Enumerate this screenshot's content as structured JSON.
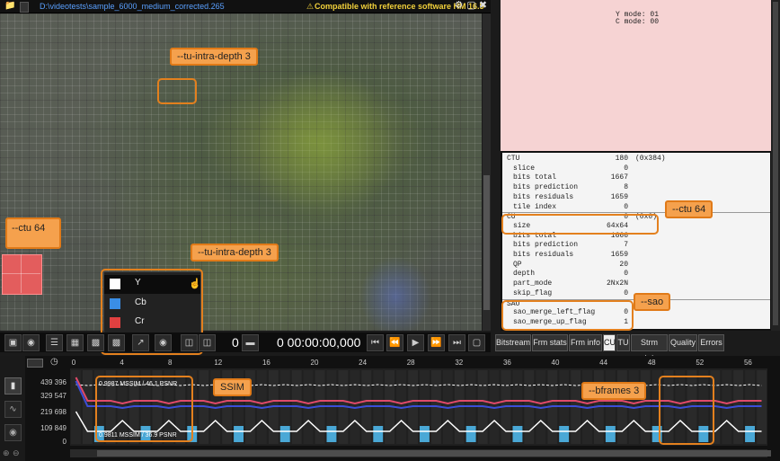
{
  "title_bar": {
    "file_path": "D:\\videotests\\sample_6000_medium_corrected.265",
    "compat_text": "Compatible with reference software HM 16.5"
  },
  "annotations": {
    "tu_intra_depth_top": "--tu-intra-depth 3",
    "tu_intra_depth_bottom": "--tu-intra-depth 3",
    "ctu_left": "--ctu 64",
    "ctu_right": "--ctu 64",
    "sao": "--sao",
    "ssim": "SSIM",
    "bframes": "--bframes 3"
  },
  "component_menu": {
    "items": [
      {
        "label": "Y",
        "color": "#ffffff"
      },
      {
        "label": "Cb",
        "color": "#3a8ee6"
      },
      {
        "label": "Cr",
        "color": "#e04040"
      }
    ]
  },
  "player": {
    "frame": "0",
    "timecode": "0 00:00:00,000"
  },
  "yuv_mode": {
    "line1": "Y mode: 01",
    "line2": "C mode: 00"
  },
  "info_rows": [
    {
      "key": "CTU",
      "val": "180",
      "extra": "(0x384)",
      "indent": false,
      "sep": false
    },
    {
      "key": "slice",
      "val": "0",
      "extra": "",
      "indent": true,
      "sep": false
    },
    {
      "key": "bits total",
      "val": "1667",
      "extra": "",
      "indent": true,
      "sep": false
    },
    {
      "key": "bits prediction",
      "val": "8",
      "extra": "",
      "indent": true,
      "sep": false
    },
    {
      "key": "bits residuals",
      "val": "1659",
      "extra": "",
      "indent": true,
      "sep": false
    },
    {
      "key": "tile index",
      "val": "0",
      "extra": "",
      "indent": true,
      "sep": false
    },
    {
      "key": "CU",
      "val": "0",
      "extra": "(0x0)",
      "indent": false,
      "sep": true
    },
    {
      "key": "size",
      "val": "64x64",
      "extra": "",
      "indent": true,
      "sep": false
    },
    {
      "key": "bits total",
      "val": "1666",
      "extra": "",
      "indent": true,
      "sep": false
    },
    {
      "key": "bits prediction",
      "val": "7",
      "extra": "",
      "indent": true,
      "sep": false
    },
    {
      "key": "bits residuals",
      "val": "1659",
      "extra": "",
      "indent": true,
      "sep": false
    },
    {
      "key": "QP",
      "val": "20",
      "extra": "",
      "indent": true,
      "sep": false
    },
    {
      "key": "depth",
      "val": "0",
      "extra": "",
      "indent": true,
      "sep": false
    },
    {
      "key": "part_mode",
      "val": "2Nx2N",
      "extra": "",
      "indent": true,
      "sep": false
    },
    {
      "key": "skip_flag",
      "val": "0",
      "extra": "",
      "indent": true,
      "sep": false
    },
    {
      "key": "SAO",
      "val": "",
      "extra": "",
      "indent": false,
      "sep": true
    },
    {
      "key": "sao_merge_left_flag",
      "val": "0",
      "extra": "",
      "indent": true,
      "sep": false
    },
    {
      "key": "sao_merge_up_flag",
      "val": "1",
      "extra": "",
      "indent": true,
      "sep": false
    }
  ],
  "tabs": [
    {
      "label": "Bitstream",
      "active": false
    },
    {
      "label": "Frm stats",
      "active": false
    },
    {
      "label": "Frm info",
      "active": false
    },
    {
      "label": "CU",
      "active": true
    },
    {
      "label": "TU",
      "active": false
    },
    {
      "label": "Strm stats",
      "active": false
    },
    {
      "label": "Quality",
      "active": false
    },
    {
      "label": "Errors",
      "active": false
    }
  ],
  "chart_data": {
    "type": "line",
    "x_ticks": [
      "0",
      "4",
      "8",
      "12",
      "16",
      "20",
      "24",
      "28",
      "32",
      "36",
      "40",
      "44",
      "48",
      "52",
      "56"
    ],
    "y_ticks": [
      "439 396",
      "329 547",
      "219 698",
      "109 849",
      "0"
    ],
    "label_top": "0.9987 MSSIM / 46.1 PSNR",
    "label_bottom": "0.9811 MSSIM / 36.9 PSNR"
  },
  "colors": {
    "annotation_fill": "#f5a14d",
    "annotation_border": "#e07a18",
    "compat_text": "#f2d13b",
    "path_text": "#5aa0ff",
    "yuv_bg": "#f6d3d3"
  }
}
